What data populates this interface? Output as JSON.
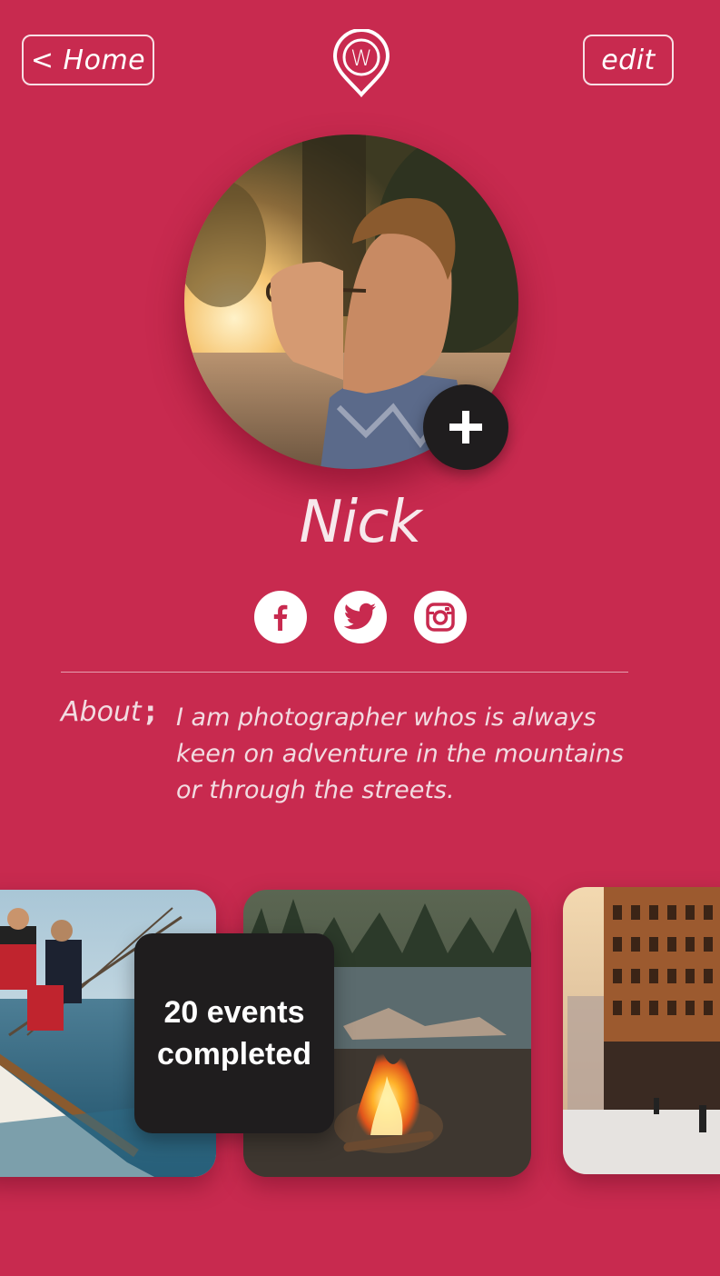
{
  "header": {
    "home_label": "< Home",
    "edit_label": "edit",
    "logo_letter": "W"
  },
  "profile": {
    "name": "Nick",
    "avatar": "profile-photo",
    "add_photo_icon": "plus-icon"
  },
  "socials": [
    {
      "name": "facebook",
      "icon": "facebook-icon"
    },
    {
      "name": "twitter",
      "icon": "twitter-icon"
    },
    {
      "name": "instagram",
      "icon": "instagram-icon"
    }
  ],
  "about": {
    "label": "About",
    "separator": ";",
    "lines": [
      "I am photographer whos is always",
      "keen on adventure in the mountains",
      "or through the streets."
    ]
  },
  "events": {
    "line1": "20 events",
    "line2": "completed"
  },
  "gallery": [
    {
      "subject": "sailing-boat"
    },
    {
      "subject": "campfire-lake"
    },
    {
      "subject": "snowy-city-street"
    }
  ],
  "colors": {
    "background": "#c82a4f",
    "dark": "#1f1d1e",
    "text": "#ffffff"
  }
}
